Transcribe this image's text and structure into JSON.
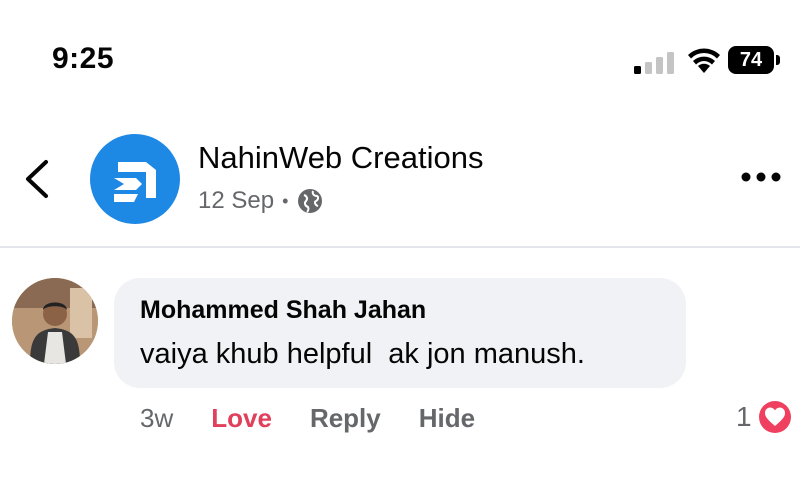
{
  "status_bar": {
    "time": "9:25",
    "battery_level": "74"
  },
  "header": {
    "page_name": "NahinWeb Creations",
    "post_date": "12 Sep",
    "separator": "•",
    "audience_icon": "globe-icon",
    "back_icon": "chevron-left-icon",
    "more_icon": "more-horizontal-icon",
    "avatar_color": "#1e88e5"
  },
  "comment": {
    "author": "Mohammed Shah Jahan",
    "text": "vaiya khub helpful  ak jon manush.",
    "time_ago": "3w",
    "actions": {
      "love": "Love",
      "reply": "Reply",
      "hide": "Hide"
    },
    "reaction_count": "1",
    "reaction_icon": "love-reaction-icon",
    "love_color": "#e0405b"
  }
}
